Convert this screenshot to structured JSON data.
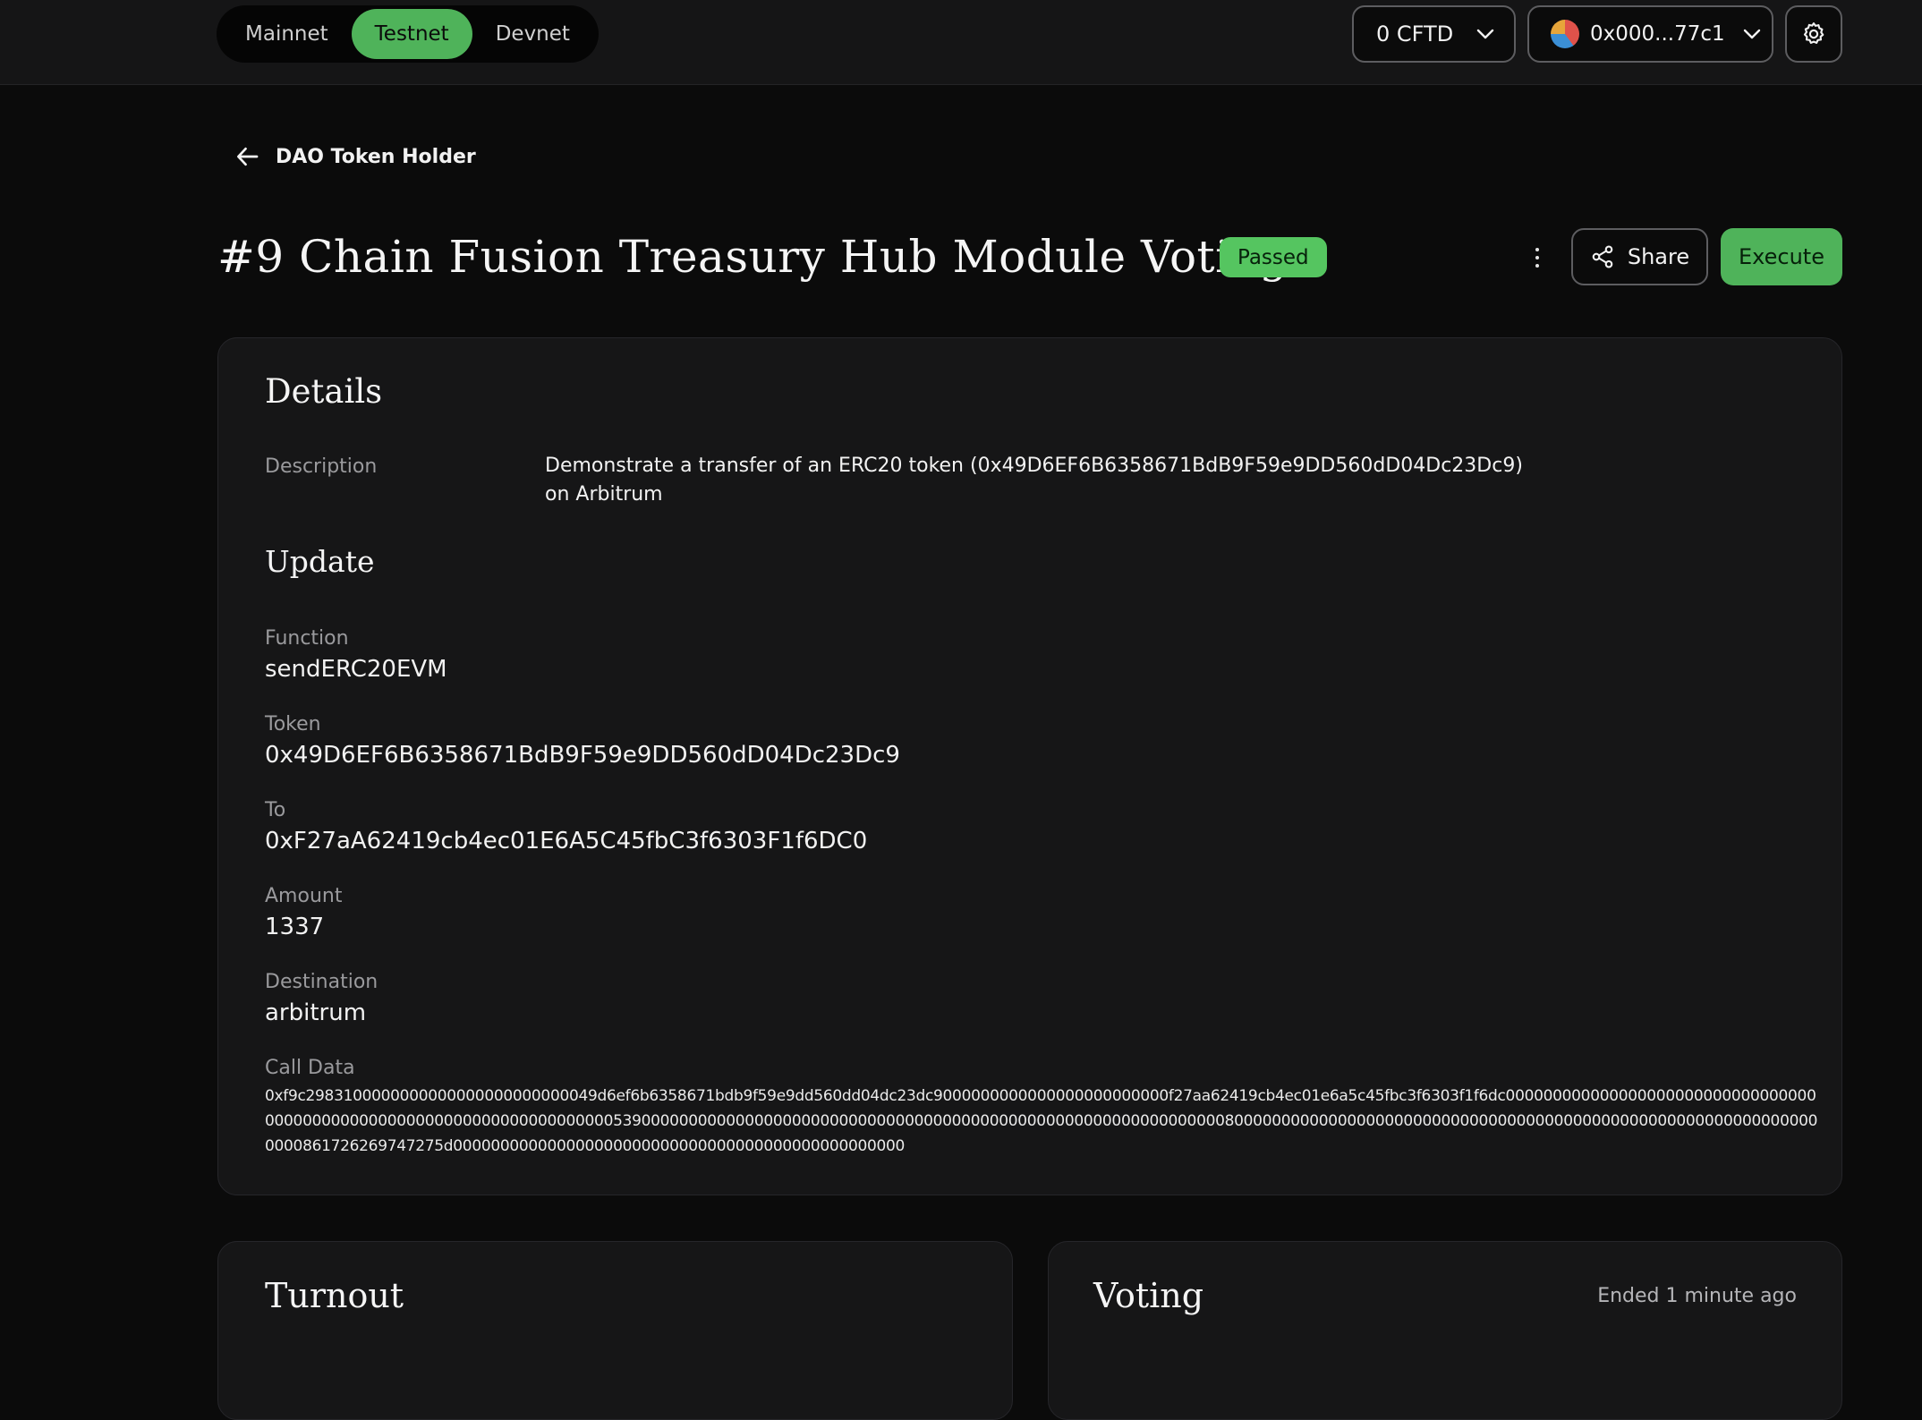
{
  "topbar": {
    "networks": [
      {
        "label": "Mainnet",
        "active": false
      },
      {
        "label": "Testnet",
        "active": true
      },
      {
        "label": "Devnet",
        "active": false
      }
    ],
    "balance_label": "0 CFTD",
    "wallet_label": "0x000...77c1"
  },
  "back_link": {
    "label": "DAO Token Holder"
  },
  "proposal": {
    "title": "#9 Chain Fusion Treasury Hub Module Voting",
    "status": "Passed",
    "share_label": "Share",
    "execute_label": "Execute"
  },
  "details": {
    "heading": "Details",
    "description_label": "Description",
    "description_value": "Demonstrate a transfer of an ERC20 token (0x49D6EF6B6358671BdB9F59e9DD560dD04Dc23Dc9) on Arbitrum",
    "update_heading": "Update",
    "fields": {
      "function_label": "Function",
      "function_value": "sendERC20EVM",
      "token_label": "Token",
      "token_value": "0x49D6EF6B6358671BdB9F59e9DD560dD04Dc23Dc9",
      "to_label": "To",
      "to_value": "0xF27aA62419cb4ec01E6A5C45fbC3f6303F1f6DC0",
      "amount_label": "Amount",
      "amount_value": "1337",
      "destination_label": "Destination",
      "destination_value": "arbitrum",
      "calldata_label": "Call Data",
      "calldata_value": "0xf9c2983100000000000000000000000049d6ef6b6358671bdb9f59e9dd560dd04dc23dc9000000000000000000000000f27aa62419cb4ec01e6a5c45fbc3f6303f1f6dc0000000000000000000000000000000000000000000000000000000000000000000000539000000000000000000000000000000000000000000000000000000000000008000000000000000000000000000000000000000000000000000000000000000000861726269747275d000000000000000000000000000000000000000000000000"
    }
  },
  "turnout": {
    "heading": "Turnout"
  },
  "voting": {
    "heading": "Voting",
    "status": "Ended 1 minute ago"
  },
  "colors": {
    "accent_green": "#4fb35a",
    "badge_green": "#55c560",
    "background": "#0b0b0b",
    "card": "#161617"
  },
  "icons": [
    "chevron-down-icon",
    "wallet-avatar",
    "gear-icon",
    "arrow-left-icon",
    "kebab-menu-icon",
    "share-icon"
  ]
}
